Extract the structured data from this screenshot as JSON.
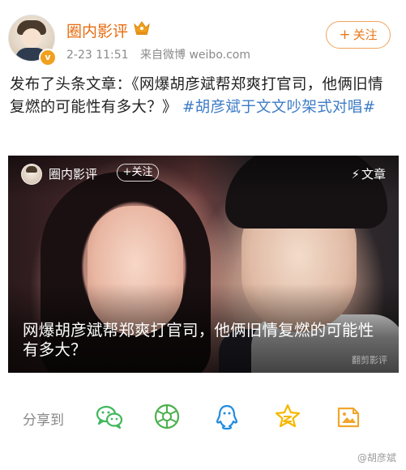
{
  "author": {
    "name": "圈内影评",
    "badge": "v"
  },
  "meta": {
    "time": "2-23 11:51",
    "source": "来自微博 weibo.com"
  },
  "follow": {
    "plus": "+",
    "label": "关注"
  },
  "post": {
    "text": "发布了头条文章：《网爆胡彦斌帮郑爽打官司，他俩旧情复燃的可能性有多大？》",
    "hashtag": "#胡彦斌于文文吵架式对唱#"
  },
  "article_card": {
    "author": "圈内影评",
    "follow_label": "+关注",
    "type_icon": "⚡",
    "type_label": "文章",
    "title": "网爆胡彦斌帮郑爽打官司，他俩旧情复燃的可能性有多大？",
    "watermark": "翻剪影评"
  },
  "share": {
    "label": "分享到",
    "targets": [
      "wechat-icon",
      "moments-icon",
      "qq-icon",
      "qzone-icon",
      "album-icon"
    ]
  },
  "colors": {
    "author_name": "#e86b0f",
    "hashtag": "#3d7bc6",
    "follow_border": "#f0a35e",
    "wechat": "#3fb75a",
    "moments": "#4cb04d",
    "qq": "#1f8ce0",
    "qzone": "#f5b800",
    "album": "#f1a62c"
  },
  "footer": {
    "watermark": "@胡彦斌"
  }
}
